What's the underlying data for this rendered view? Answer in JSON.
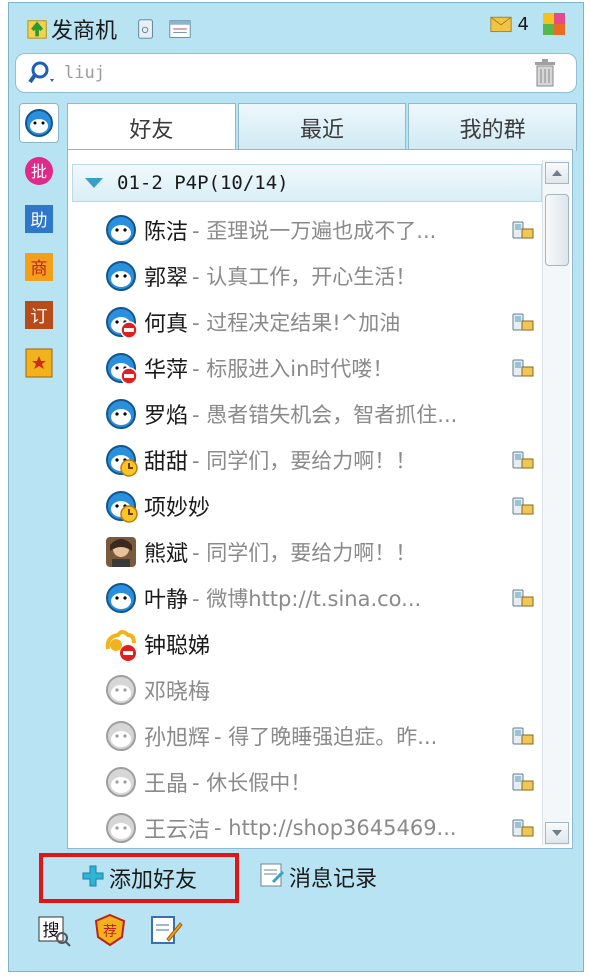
{
  "topbar": {
    "brand_label": "发商机",
    "msg_count": "4",
    "icons": [
      "send-opportunity-icon",
      "phone-icon",
      "calendar-icon",
      "mail-icon",
      "color-palette-icon"
    ]
  },
  "search": {
    "value": "liuj",
    "icons": [
      "search-icon",
      "trash-icon"
    ]
  },
  "rail": {
    "icons": [
      "contacts-icon",
      "batch-icon",
      "assistant-icon",
      "business-icon",
      "order-icon",
      "favorites-icon"
    ]
  },
  "tabs": [
    "好友",
    "最近",
    "我的群"
  ],
  "group": {
    "label": "01-2 P4P(10/14)"
  },
  "friends": [
    {
      "name": "陈洁",
      "sig": " - 歪理说一万遍也成不了...",
      "status": "online",
      "mobile": true
    },
    {
      "name": "郭翠",
      "sig": " - 认真工作，开心生活！",
      "status": "online",
      "mobile": false
    },
    {
      "name": "何真",
      "sig": " - 过程决定结果!^加油",
      "status": "busy",
      "mobile": true
    },
    {
      "name": "华萍",
      "sig": " - 标服进入in时代喽！",
      "status": "busy",
      "mobile": true
    },
    {
      "name": "罗焰",
      "sig": " - 愚者错失机会，智者抓住...",
      "status": "online",
      "mobile": false
    },
    {
      "name": "甜甜",
      "sig": " - 同学们，要给力啊！！",
      "status": "away",
      "mobile": true
    },
    {
      "name": "项妙妙",
      "sig": "",
      "status": "away",
      "mobile": true
    },
    {
      "name": "熊斌",
      "sig": " - 同学们，要给力啊！！",
      "status": "photo",
      "mobile": false
    },
    {
      "name": "叶静",
      "sig": " - 微博http://t.sina.co...",
      "status": "online",
      "mobile": true
    },
    {
      "name": "钟聪娣",
      "sig": "",
      "status": "busy-alt",
      "mobile": false
    },
    {
      "name": "邓晓梅",
      "sig": "",
      "status": "offline",
      "mobile": false
    },
    {
      "name": "孙旭辉",
      "sig": " - 得了晚睡强迫症。昨...",
      "status": "offline",
      "mobile": true
    },
    {
      "name": "王晶",
      "sig": " - 休长假中！",
      "status": "offline",
      "mobile": true
    },
    {
      "name": "王云洁",
      "sig": " - http://shop3645469...",
      "status": "offline",
      "mobile": true
    }
  ],
  "bottom": {
    "add_friend_label": "添加好友",
    "history_label": "消息记录",
    "tool_icons": [
      "find-icon",
      "recommend-icon",
      "note-icon"
    ]
  },
  "colors": {
    "accent": "#3a9ecb",
    "highlight": "#e01515",
    "background": "#b7e3f2"
  }
}
